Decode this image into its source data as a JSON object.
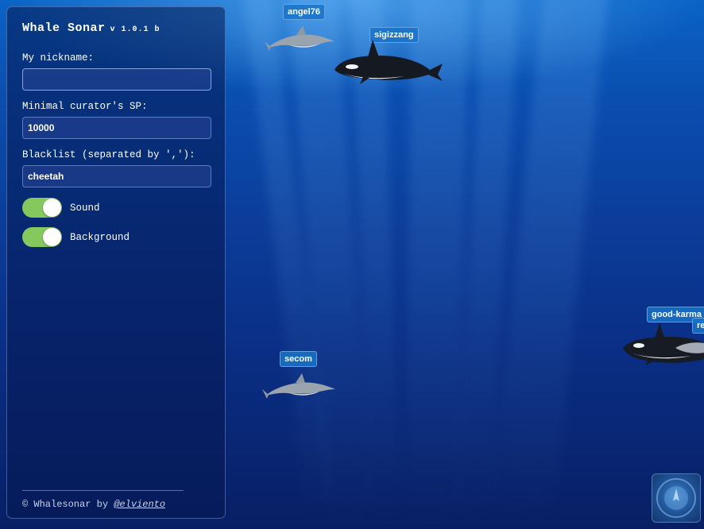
{
  "app": {
    "title": "Whale Sonar",
    "version": "v 1.0.1 b"
  },
  "form": {
    "nickname": {
      "label": "My nickname:",
      "value": ""
    },
    "min_sp": {
      "label": "Minimal curator's SP:",
      "value": "10000"
    },
    "blacklist": {
      "label": "Blacklist (separated by ','):",
      "value": "cheetah"
    }
  },
  "toggles": {
    "sound": {
      "label": "Sound",
      "on": true
    },
    "background": {
      "label": "Background",
      "on": true
    }
  },
  "footer": {
    "prefix": "© Whalesonar by",
    "link": "@elviento"
  },
  "creatures": [
    {
      "name": "angel76",
      "kind": "dolphin"
    },
    {
      "name": "sigizzang",
      "kind": "orca"
    },
    {
      "name": "good-karma_",
      "kind": "orca"
    },
    {
      "name": "re",
      "kind": "dolphin"
    },
    {
      "name": "secom",
      "kind": "dolphin"
    }
  ],
  "colors": {
    "toggle_on": "#85c85e",
    "tag_bg": "#1973c8",
    "panel_border": "#8caae6"
  },
  "icons": {
    "sonar": "sonar-icon"
  }
}
